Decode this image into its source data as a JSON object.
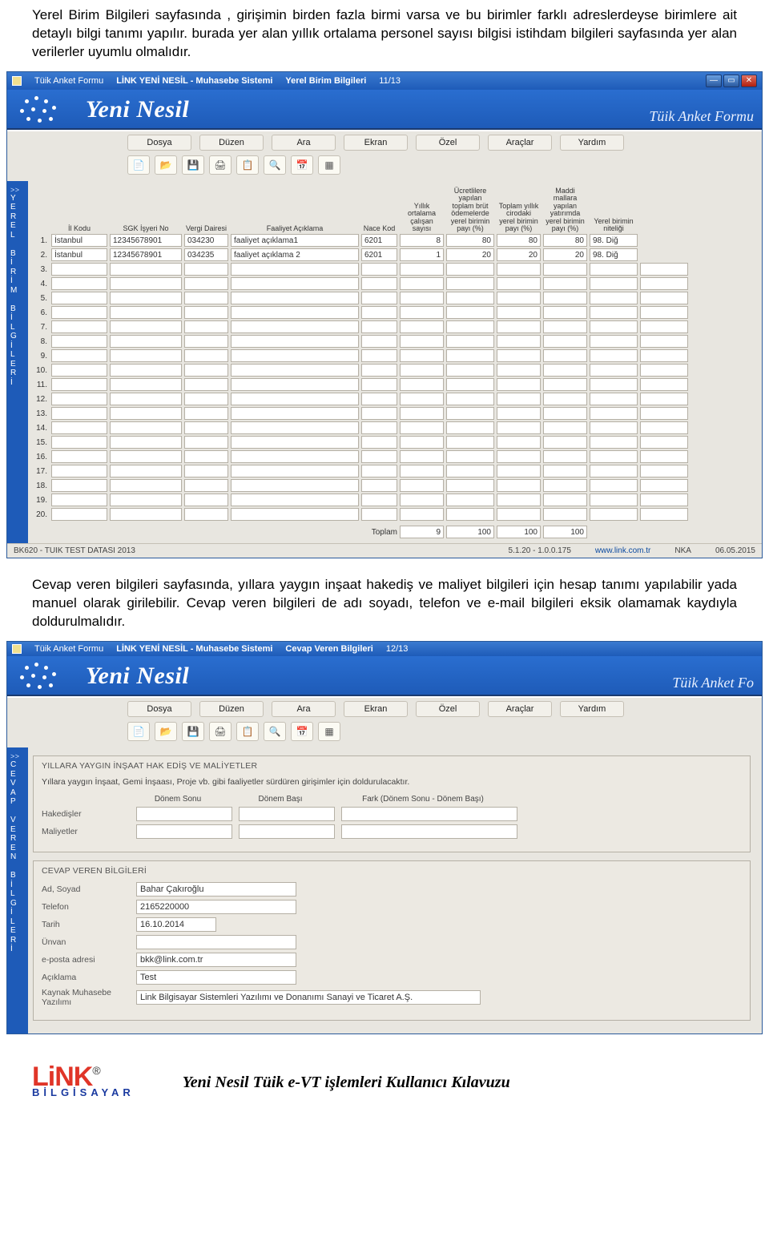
{
  "doc": {
    "para1": "Yerel Birim Bilgileri sayfasında , girişimin birden fazla birmi varsa ve bu birimler farklı adreslerdeyse birimlere ait detaylı bilgi tanımı yapılır. burada yer alan yıllık ortalama personel sayısı bilgisi istihdam bilgileri sayfasında yer alan verilerler uyumlu olmalıdır.",
    "para2": "Cevap veren bilgileri sayfasında, yıllara yaygın inşaat hakediş ve maliyet bilgileri için hesap tanımı yapılabilir yada manuel olarak girilebilir. Cevap veren bilgileri de adı soyadı, telefon ve e-mail bilgileri eksik olamamak kaydıyla doldurulmalıdır."
  },
  "app": {
    "title_form": "Tüik Anket Formu",
    "title_sys": "LİNK YENİ NESİL  -  Muhasebe Sistemi",
    "screen1": "Yerel Birim Bilgileri",
    "page1": "11/13",
    "screen2": "Cevap Veren Bilgileri",
    "page2": "12/13",
    "brand": "Yeni Nesil",
    "brand_right": "Tüik Anket Formu",
    "brand_right2": "Tüik Anket Fo",
    "menu": [
      "Dosya",
      "Düzen",
      "Ara",
      "Ekran",
      "Özel",
      "Araçlar",
      "Yardım"
    ]
  },
  "sidebar1": "YEREL BİRİM BİLGİLERİ",
  "sidebar2": "CEVAP VEREN BİLGİLERİ",
  "grid": {
    "headers": [
      "",
      "İl Kodu",
      "SGK İşyeri No",
      "Vergi Dairesi",
      "Faaliyet Açıklama",
      "Nace Kod",
      "Yıllık ortalama çalışan sayısı",
      "Ücretlilere yapılan toplam brüt ödemelerde yerel birimin payı (%)",
      "Toplam yıllık cirodaki yerel birimin payı (%)",
      "Maddi mallara yapılan yatırımda yerel birimin payı (%)",
      "Yerel birimin niteliği"
    ],
    "rows": [
      {
        "n": "1.",
        "il": "İstanbul",
        "sgk": "12345678901",
        "vd": "034230",
        "faal": "faaliyet açıklama1",
        "nace": "6201",
        "cal": "8",
        "p1": "80",
        "p2": "80",
        "p3": "80",
        "nit": "98. Diğ"
      },
      {
        "n": "2.",
        "il": "İstanbul",
        "sgk": "12345678901",
        "vd": "034235",
        "faal": "faaliyet açıklama 2",
        "nace": "6201",
        "cal": "1",
        "p1": "20",
        "p2": "20",
        "p3": "20",
        "nit": "98. Diğ"
      }
    ],
    "total_label": "Toplam",
    "totals": {
      "cal": "9",
      "p1": "100",
      "p2": "100",
      "p3": "100"
    }
  },
  "status": {
    "left": "BK620 - TUIK TEST DATASI  2013",
    "ver": "5.1.20 - 1.0.0.175",
    "url": "www.link.com.tr",
    "mid": "NKA",
    "date": "06.05.2015"
  },
  "form2": {
    "g1_title": "YILLARA YAYGIN İNŞAAT HAK EDİŞ VE MALİYETLER",
    "desc": "Yıllara yaygın İnşaat, Gemi İnşaası, Proje vb. gibi faaliyetler sürdüren girişimler için doldurulacaktır.",
    "col1": "Dönem Sonu",
    "col2": "Dönem Başı",
    "col3": "Fark (Dönem Sonu - Dönem Başı)",
    "r1": "Hakedişler",
    "r2": "Maliyetler",
    "g2_title": "CEVAP VEREN BİLGİLERİ",
    "f_ad": "Ad, Soyad",
    "v_ad": "Bahar Çakıroğlu",
    "f_tel": "Telefon",
    "v_tel": "2165220000",
    "f_tarih": "Tarih",
    "v_tarih": "16.10.2014",
    "f_unvan": "Ünvan",
    "v_unvan": "",
    "f_eposta": "e-posta adresi",
    "v_eposta": "bkk@link.com.tr",
    "f_acik": "Açıklama",
    "v_acik": "Test",
    "f_kaynak": "Kaynak Muhasebe Yazılımı",
    "v_kaynak": "Link Bilgisayar Sistemleri Yazılımı ve Donanımı Sanayi ve Ticaret A.Ş."
  },
  "footer": {
    "brand": "LiNK",
    "reg": "®",
    "sub": "BİLGİSAYAR",
    "title": "Yeni Nesil Tüik e-VT işlemleri Kullanıcı Kılavuzu"
  }
}
